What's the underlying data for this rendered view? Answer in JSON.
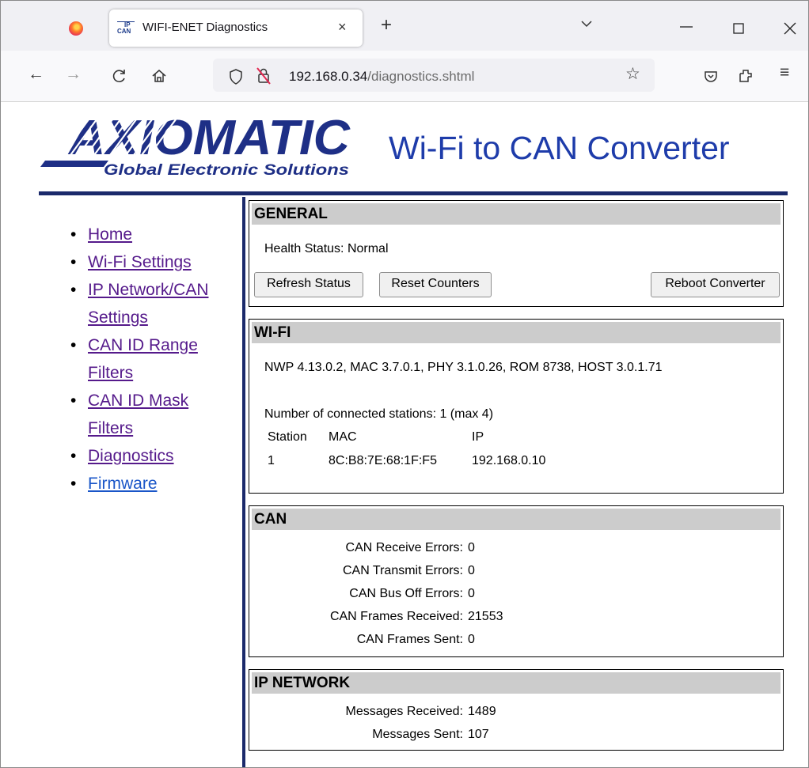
{
  "browser": {
    "tab": {
      "favicon_text_top": "IP",
      "favicon_text_bottom": "CAN",
      "title": "WIFI-ENET Diagnostics",
      "close": "×"
    },
    "new_tab": "+",
    "list_tabs": "⌵",
    "window": {
      "minimize": "—",
      "maximize": "☐",
      "close": "✕"
    },
    "nav": {
      "back": "←",
      "forward": "→",
      "reload": "C",
      "home": "⌂",
      "bookmark": "☆",
      "pocket": "♡",
      "extensions": "⇱",
      "menu": "≡"
    },
    "url": {
      "host": "192.168.0.34",
      "path": "/diagnostics.shtml"
    }
  },
  "header": {
    "logo_word": "AXIOMATIC",
    "logo_tagline": "Global Electronic Solutions",
    "title": "Wi-Fi to CAN Converter"
  },
  "menu": [
    {
      "label": "Home"
    },
    {
      "label": "Wi-Fi Settings"
    },
    {
      "label": "IP Network/CAN Settings",
      "l1": "IP Network/CAN",
      "l2": "Settings"
    },
    {
      "label": "CAN ID Range Filters",
      "l1": "CAN ID Range",
      "l2": "Filters"
    },
    {
      "label": "CAN ID Mask Filters",
      "l1": "CAN ID Mask",
      "l2": "Filters"
    },
    {
      "label": "Diagnostics"
    },
    {
      "label": "Firmware"
    }
  ],
  "general": {
    "heading": "GENERAL",
    "health": "Health Status: Normal",
    "buttons": {
      "refresh": "Refresh Status",
      "reset": "Reset Counters",
      "reboot": "Reboot Converter"
    }
  },
  "wifi": {
    "heading": "WI-FI",
    "versions": "NWP 4.13.0.2, MAC 3.7.0.1, PHY 3.1.0.26, ROM 8738, HOST 3.0.1.71",
    "stations": "Number of connected stations: 1 (max 4)",
    "columns": [
      "Station",
      "MAC",
      "IP"
    ],
    "rows": [
      [
        "1",
        "8C:B8:7E:68:1F:F5",
        "192.168.0.10"
      ]
    ]
  },
  "can": {
    "heading": "CAN",
    "rows": [
      {
        "label": "CAN Receive Errors:",
        "value": "0"
      },
      {
        "label": "CAN Transmit Errors:",
        "value": "0"
      },
      {
        "label": "CAN Bus Off Errors:",
        "value": "0"
      },
      {
        "label": "CAN Frames Received:",
        "value": "21553"
      },
      {
        "label": "CAN Frames Sent:",
        "value": "0"
      }
    ]
  },
  "ipnet": {
    "heading": "IP NETWORK",
    "rows": [
      {
        "label": "Messages Received:",
        "value": "1489"
      },
      {
        "label": "Messages Sent:",
        "value": "107"
      }
    ]
  }
}
